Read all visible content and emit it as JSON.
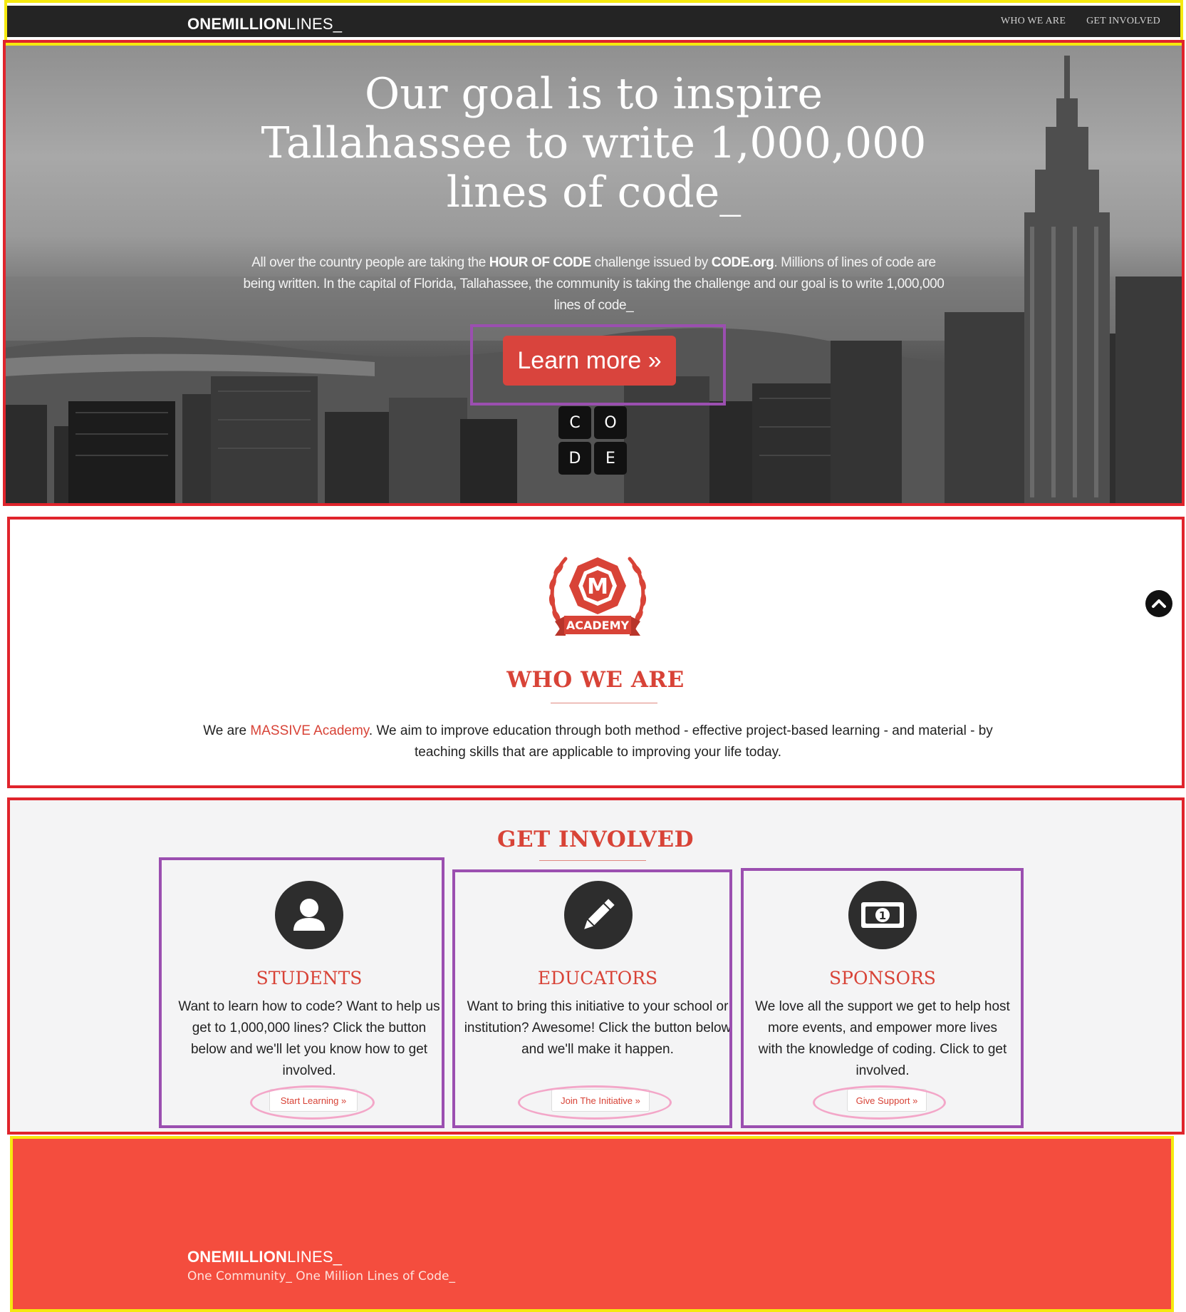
{
  "nav": {
    "brand_bold": "ONEMILLION",
    "brand_light": "LINES_",
    "links": [
      "WHO WE ARE",
      "GET INVOLVED"
    ]
  },
  "hero": {
    "title_lines": [
      "Our goal is to inspire",
      "Tallahassee to write 1,000,000",
      "lines of code_"
    ],
    "text_before_hoc": "All over the country people are taking the ",
    "hoc": "HOUR OF CODE",
    "text_mid": " challenge issued by ",
    "codeorg": "CODE.org",
    "text_after": ". Millions of lines of code are being written. In the capital of Florida, Tallahassee, the community is taking the challenge and our goal is to write 1,000,000 lines of code_",
    "button_label": "Learn more »",
    "code_letters": [
      "C",
      "O",
      "D",
      "E"
    ]
  },
  "who": {
    "badge_letter": "M",
    "badge_label": "ACADEMY",
    "title": "WHO WE ARE",
    "text_before": "We are ",
    "accent": "MASSIVE Academy",
    "text_after": ". We aim to improve education through both method - effective project-based learning - and material - by teaching skills that are applicable to improving your life today."
  },
  "involved": {
    "title": "GET INVOLVED",
    "cards": [
      {
        "icon": "user-icon",
        "title": "STUDENTS",
        "text": "Want to learn how to code? Want to help us get to 1,000,000 lines? Click the button below and we'll let you know how to get involved.",
        "button": "Start Learning »"
      },
      {
        "icon": "pencil-icon",
        "title": "EDUCATORS",
        "text": "Want to bring this initiative to your school or institution? Awesome! Click the button below and we'll make it happen.",
        "button": "Join The Initiative »"
      },
      {
        "icon": "money-icon",
        "title": "SPONSORS",
        "text": "We love all the support we get to help host more events, and empower more lives with the knowledge of coding. Click to get involved.",
        "button": "Give Support »"
      }
    ]
  },
  "footer": {
    "brand_bold": "ONEMILLION",
    "brand_light": "LINES_",
    "tagline": "One Community_ One Million Lines of Code_"
  },
  "colors": {
    "accent": "#d84337",
    "footer_bg": "#f44d3e",
    "nav_bg": "#242424"
  }
}
